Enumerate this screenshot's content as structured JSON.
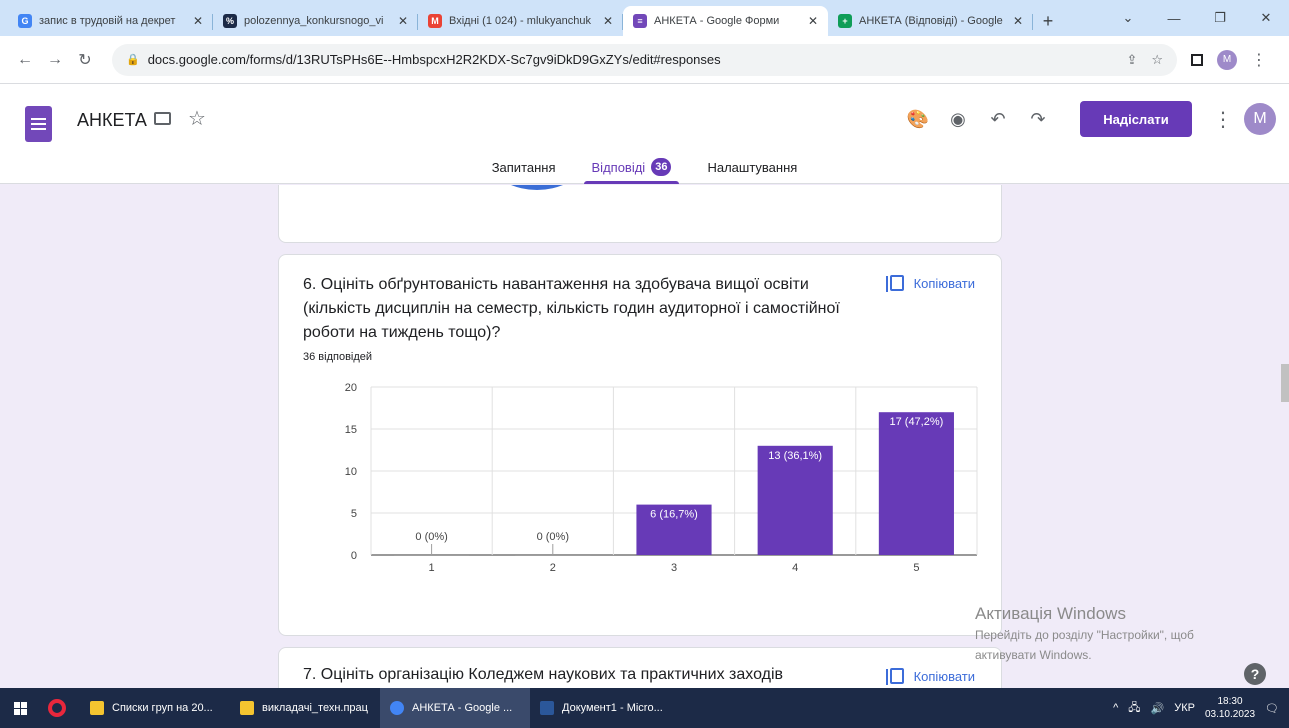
{
  "browser": {
    "tabs": [
      {
        "title": "запис в трудовій на декрет",
        "fav_color": "#4285f4",
        "fav_glyph": "G"
      },
      {
        "title": "polozennya_konkursnogo_vi",
        "fav_color": "#1c2a47",
        "fav_glyph": "%"
      },
      {
        "title": "Вхідні (1 024) - mlukyanchuk",
        "fav_color": "#ea4335",
        "fav_glyph": "M"
      },
      {
        "title": "АНКЕТА - Google Форми",
        "fav_color": "#7248b9",
        "fav_glyph": "≡",
        "active": true
      },
      {
        "title": "АНКЕТА (Відповіді) - Google",
        "fav_color": "#0f9d58",
        "fav_glyph": "+"
      }
    ],
    "tab_close": "✕",
    "new_tab": "+",
    "win_controls": [
      "⌄",
      "—",
      "❐",
      "✕"
    ],
    "url": "docs.google.com/forms/d/13RUTsPHs6E--HmbspcxH2R2KDX-Sc7gv9iDkD9GxZYs/edit#responses",
    "profile_initial": "M"
  },
  "header": {
    "title": "АНКЕТА",
    "send_label": "Надіслати",
    "avatar_initial": "M",
    "tabs": [
      {
        "label": "Запитання"
      },
      {
        "label": "Відповіді",
        "badge": "36",
        "active": true
      },
      {
        "label": "Налаштування"
      }
    ]
  },
  "question6": {
    "title": "6. Оцініть обґрунтованість навантаження на здобувача вищої освіти (кількість дисциплін на семестр, кількість годин аудиторної і самостійної роботи на тиждень тощо)?",
    "copy_label": "Копіювати",
    "responses": "36 відповідей"
  },
  "question7": {
    "title": "7. Оцініть організацію  Коледжем наукових та практичних заходів",
    "copy_label": "Копіювати"
  },
  "chart_data": {
    "type": "bar",
    "categories": [
      "1",
      "2",
      "3",
      "4",
      "5"
    ],
    "values": [
      0,
      0,
      6,
      13,
      17
    ],
    "labels": [
      "0 (0%)",
      "0 (0%)",
      "6 (16,7%)",
      "13 (36,1%)",
      "17 (47,2%)"
    ],
    "yticks": [
      0,
      5,
      10,
      15,
      20
    ],
    "ylim": [
      0,
      20
    ],
    "grid": true,
    "color": "#673ab7"
  },
  "watermark": {
    "line1": "Активація Windows",
    "line2": "Перейдіть до розділу \"Настройки\", щоб",
    "line3": "активувати Windows."
  },
  "taskbar": {
    "items": [
      {
        "label": "Списки груп на 20...",
        "color": "#f4c430"
      },
      {
        "label": "викладачі_техн.прац",
        "color": "#f4c430"
      },
      {
        "label": "АНКЕТА - Google ...",
        "color": "#4285f4",
        "active": true
      },
      {
        "label": "Документ1 - Micro...",
        "color": "#2b579a"
      }
    ],
    "lang": "УКР",
    "time": "18:30",
    "date": "03.10.2023"
  }
}
